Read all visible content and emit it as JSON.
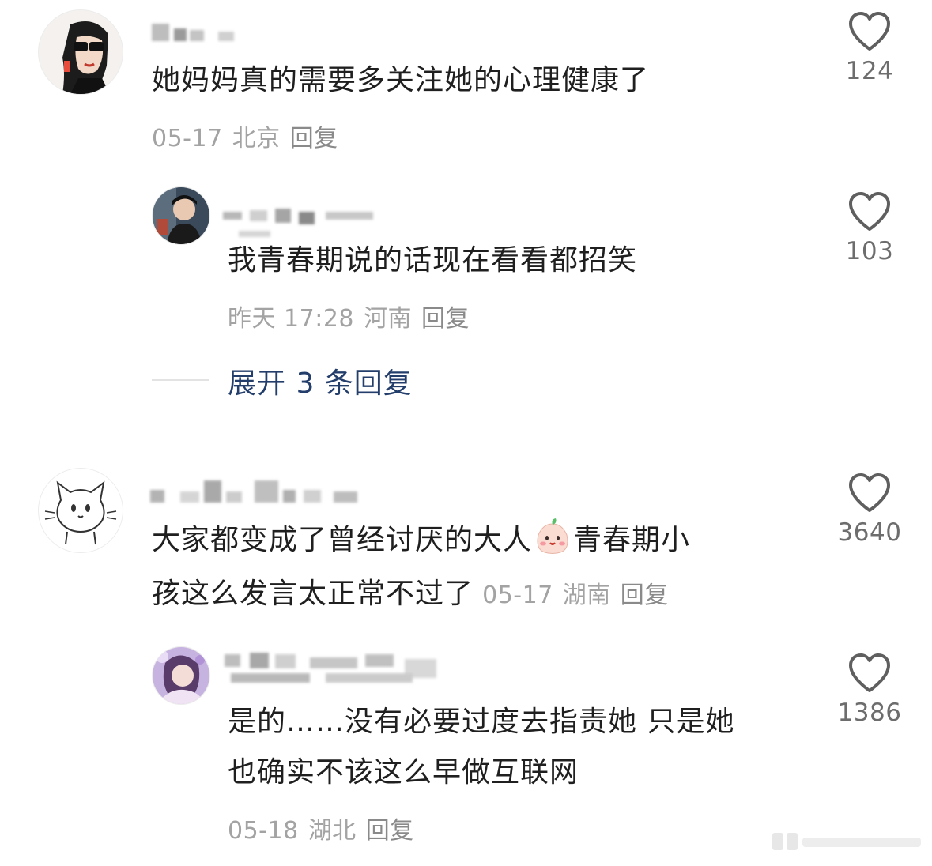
{
  "comments": [
    {
      "text": "她妈妈真的需要多关注她的心理健康了",
      "date": "05-17",
      "location": "北京",
      "reply": "回复",
      "likes": "124",
      "avatar": "woman-sunglasses-avatar"
    },
    {
      "text": "我青春期说的话现在看看都招笑",
      "date": "昨天 17:28",
      "location": "河南",
      "reply": "回复",
      "likes": "103",
      "avatar": "young-man-photo-avatar"
    },
    {
      "text_line1_a": "大家都变成了曾经讨厌的大人",
      "emoji": "blushing-face-emoji",
      "text_line1_b": "青春期小",
      "text_line2": "孩这么发言太正常不过了",
      "date": "05-17",
      "location": "湖南",
      "reply": "回复",
      "likes": "3640",
      "avatar": "cartoon-cat-avatar"
    },
    {
      "text_line1": "是的……没有必要过度去指责她 只是她",
      "text_line2": "也确实不该这么早做互联网",
      "date": "05-18",
      "location": "湖北",
      "reply": "回复",
      "likes": "1386",
      "avatar": "girl-purple-photo-avatar"
    }
  ],
  "expand_replies": "展开 3 条回复",
  "colors": {
    "text": "#1f1f1f",
    "meta": "#a3a3a3",
    "link": "#243e6b",
    "heart": "#5f5f5f"
  }
}
